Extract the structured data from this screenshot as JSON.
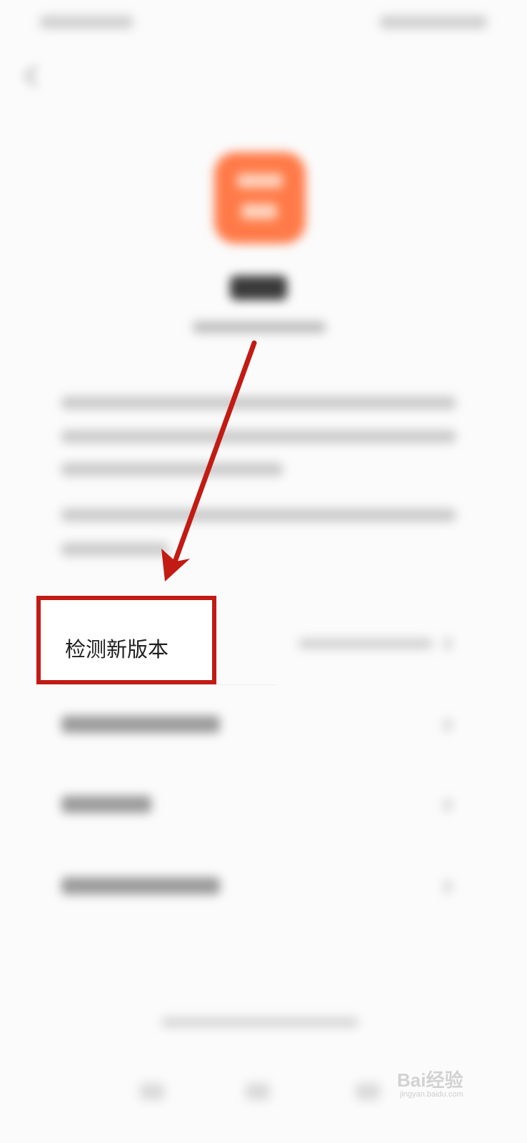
{
  "highlighted_item": {
    "label": "检测新版本"
  },
  "watermark": {
    "brand": "Bai经验",
    "url": "jingyan.baidu.com"
  },
  "colors": {
    "accent": "#c11b14",
    "app_icon": "#ff7a48"
  },
  "icons": [
    "back-icon",
    "chevron-right-icon",
    "arrow-annotation-icon"
  ]
}
